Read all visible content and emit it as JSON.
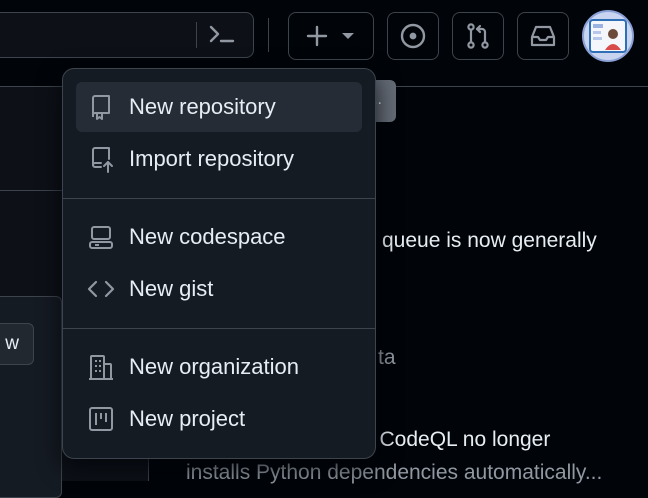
{
  "header": {
    "command_icon": "terminal-icon",
    "create_button": {
      "plus_icon": "plus-icon",
      "caret_icon": "triangle-down-icon"
    },
    "issues_icon": "issue-opened-icon",
    "pull_requests_icon": "git-pull-request-icon",
    "inbox_icon": "inbox-icon"
  },
  "background": {
    "left_button_label": "w",
    "grey_button_label": "..",
    "feed": [
      "queue is now generally",
      "ta",
      "n CodeQL no longer",
      "installs Python dependencies automatically..."
    ]
  },
  "create_menu": {
    "groups": [
      [
        {
          "label": "New repository",
          "icon": "repo-icon"
        },
        {
          "label": "Import repository",
          "icon": "repo-push-icon"
        }
      ],
      [
        {
          "label": "New codespace",
          "icon": "codespaces-icon"
        },
        {
          "label": "New gist",
          "icon": "code-icon"
        }
      ],
      [
        {
          "label": "New organization",
          "icon": "organization-icon"
        },
        {
          "label": "New project",
          "icon": "project-icon"
        }
      ]
    ]
  },
  "colors": {
    "page_bg": "#010409",
    "menu_bg": "#151b23",
    "border": "#3d444d",
    "text": "#e6edf3",
    "muted": "#9198a1",
    "active_item_bg": "#262c36"
  }
}
